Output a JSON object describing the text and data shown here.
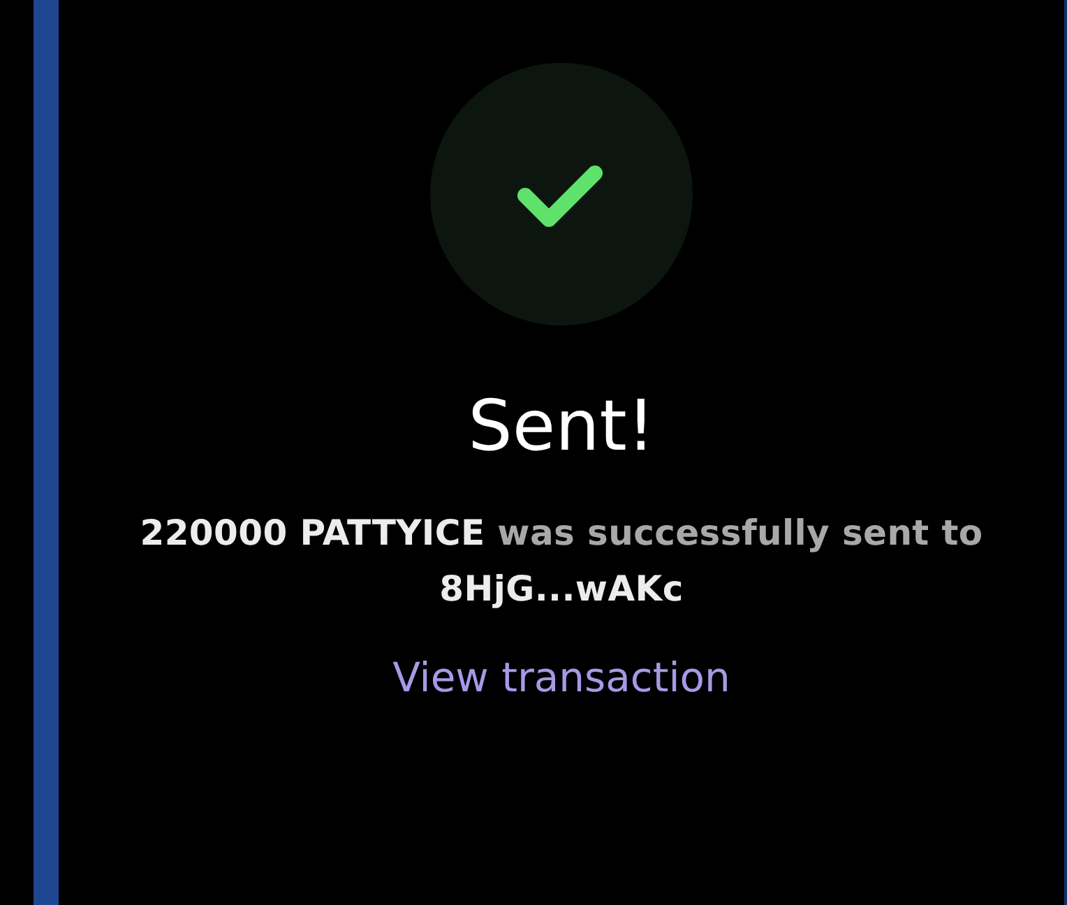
{
  "status": {
    "title": "Sent!"
  },
  "message": {
    "amount": "220000 PATTYICE",
    "text": "was successfully sent to",
    "recipient": "8HjG...wAKc"
  },
  "link": {
    "label": "View transaction"
  }
}
